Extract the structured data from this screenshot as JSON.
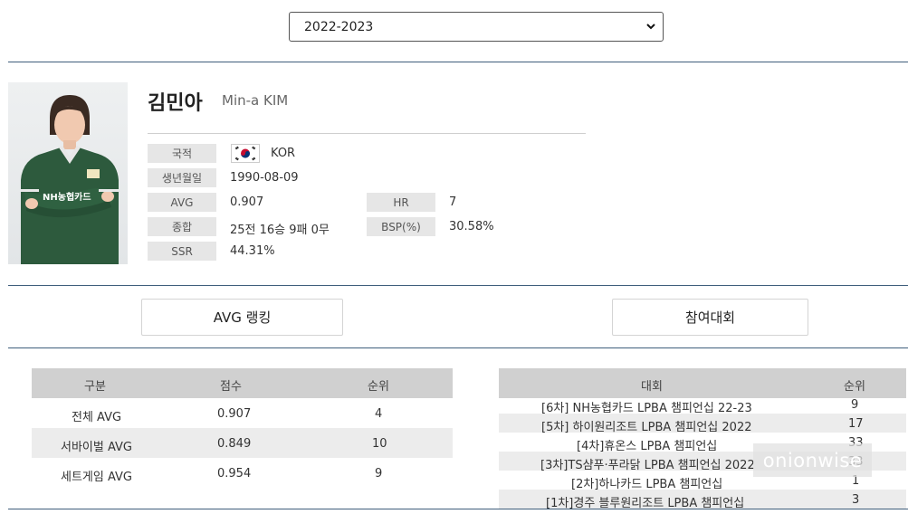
{
  "season_select": {
    "value": "2022-2023"
  },
  "player": {
    "name_ko": "김민아",
    "name_en": "Min-a KIM"
  },
  "profile": {
    "nationality_label": "국적",
    "nationality_value": "KOR",
    "birth_label": "생년월일",
    "birth_value": "1990-08-09",
    "avg_label": "AVG",
    "avg_value": "0.907",
    "hr_label": "HR",
    "hr_value": "7",
    "record_label": "종합",
    "record_value": "25전 16승 9패 0무",
    "bsp_label": "BSP(%)",
    "bsp_value": "30.58%",
    "ssr_label": "SSR",
    "ssr_value": "44.31%"
  },
  "photo": {
    "shirt_text": "NH농협카드"
  },
  "tabs": {
    "avg_ranking": "AVG 랭킹",
    "tournaments": "참여대회"
  },
  "avg_table": {
    "headers": [
      "구분",
      "점수",
      "순위"
    ],
    "rows": [
      [
        "전체 AVG",
        "0.907",
        "4"
      ],
      [
        "서바이벌 AVG",
        "0.849",
        "10"
      ],
      [
        "세트게임 AVG",
        "0.954",
        "9"
      ]
    ]
  },
  "tournament_table": {
    "headers": [
      "대회",
      "순위"
    ],
    "rows": [
      [
        "[6차] NH농협카드 LPBA 챔피언십 22-23",
        "9"
      ],
      [
        "[5차] 하이원리조트 LPBA 챔피언십 2022",
        "17"
      ],
      [
        "[4차]휴온스 LPBA 챔피언십",
        "33"
      ],
      [
        "[3차]TS샴푸·푸라닭 LPBA 챔피언십 2022",
        "33"
      ],
      [
        "[2차]하나카드 LPBA 챔피언십",
        "1"
      ],
      [
        "[1차]경주 블루원리조트 LPBA 챔피언십",
        "3"
      ]
    ]
  },
  "watermark": "onionwise",
  "colors": {
    "rule": "#3f5e7c",
    "table_header": "#d0d0d0",
    "label_bg": "#e6e6e6"
  }
}
